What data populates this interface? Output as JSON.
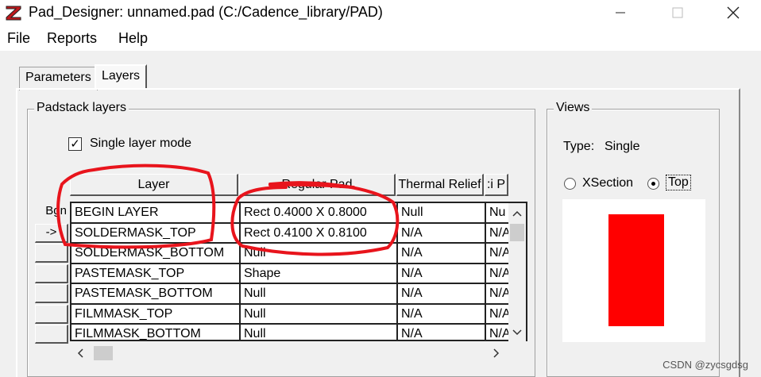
{
  "window": {
    "title": "Pad_Designer: unnamed.pad (C:/Cadence_library/PAD)",
    "icon": "pad-designer-app-icon"
  },
  "menu": {
    "file": "File",
    "reports": "Reports",
    "help": "Help"
  },
  "tabs": {
    "parameters": "Parameters",
    "layers": "Layers"
  },
  "padstack": {
    "group_label": "Padstack layers",
    "single_layer_mode_label": "Single layer mode",
    "single_layer_mode_checked": true,
    "columns": [
      "Layer",
      "Regular Pad",
      "Thermal Relief",
      "Anti Pad"
    ],
    "visible_column_headers": {
      "layer": "Layer",
      "regular_pad": "Regular Pad",
      "thermal_relief": "Thermal Relief",
      "anti_pad_clipped": ":i P"
    },
    "row_buttons": {
      "first": "Bgn",
      "current": "->"
    },
    "rows": [
      {
        "layer": "BEGIN LAYER",
        "regular": "Rect 0.4000 X 0.8000",
        "thermal": "Null",
        "anti": "Nu"
      },
      {
        "layer": "SOLDERMASK_TOP",
        "regular": "Rect 0.4100 X 0.8100",
        "thermal": "N/A",
        "anti": "N/A"
      },
      {
        "layer": "SOLDERMASK_BOTTOM",
        "regular": "Null",
        "thermal": "N/A",
        "anti": "N/A"
      },
      {
        "layer": "PASTEMASK_TOP",
        "regular": "Shape",
        "thermal": "N/A",
        "anti": "N/A"
      },
      {
        "layer": "PASTEMASK_BOTTOM",
        "regular": "Null",
        "thermal": "N/A",
        "anti": "N/A"
      },
      {
        "layer": "FILMMASK_TOP",
        "regular": "Null",
        "thermal": "N/A",
        "anti": "N/A"
      },
      {
        "layer": "FILMMASK_BOTTOM",
        "regular": "Null",
        "thermal": "N/A",
        "anti": "N/A"
      }
    ]
  },
  "views": {
    "group_label": "Views",
    "type_label": "Type:",
    "type_value": "Single",
    "xsection_label": "XSection",
    "top_label": "Top",
    "selected": "Top",
    "pad_color": "#ff0000"
  },
  "watermark": "CSDN @zycsgdsg",
  "colors": {
    "annotation": "#e8141c"
  }
}
